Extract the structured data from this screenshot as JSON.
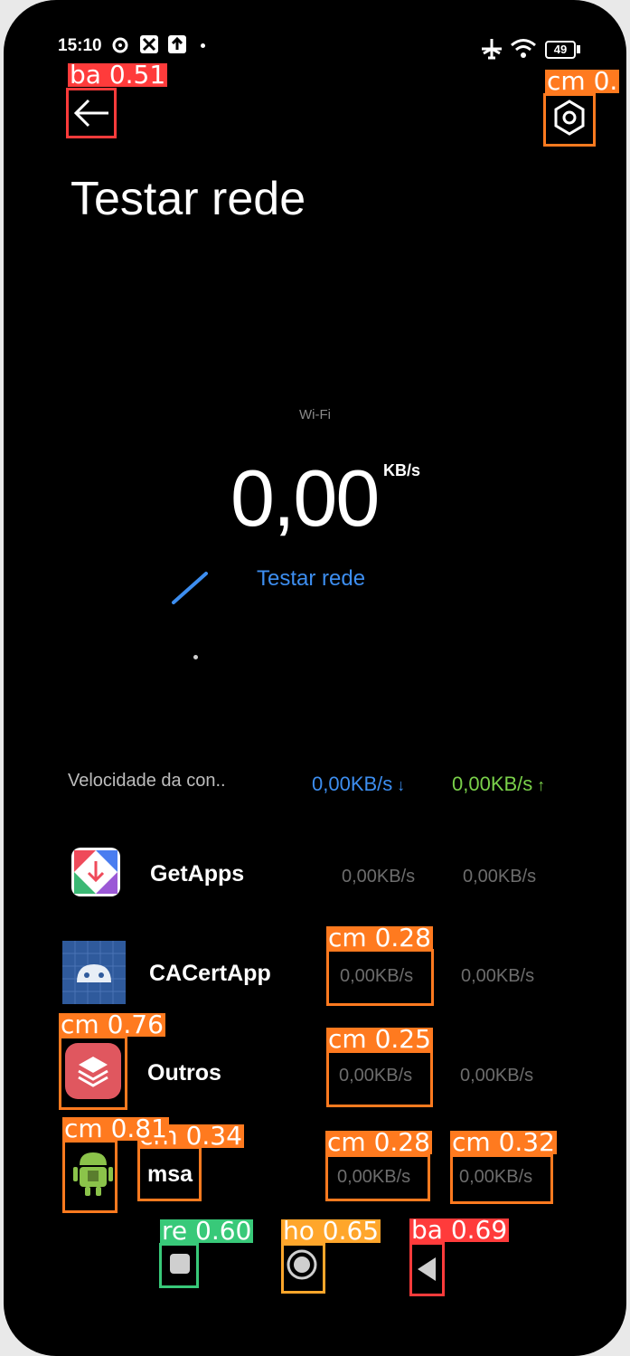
{
  "status_bar": {
    "time": "15:10",
    "battery": "49"
  },
  "page": {
    "title": "Testar rede"
  },
  "speed": {
    "network": "Wi-Fi",
    "value": "0,00",
    "unit": "KB/s",
    "test_link": "Testar rede"
  },
  "connection": {
    "label": "Velocidade da con..",
    "download": "0,00KB/s",
    "upload": "0,00KB/s"
  },
  "apps": [
    {
      "name": "GetApps",
      "down": "0,00KB/s",
      "up": "0,00KB/s"
    },
    {
      "name": "CACertApp",
      "down": "0,00KB/s",
      "up": "0,00KB/s"
    },
    {
      "name": "Outros",
      "down": "0,00KB/s",
      "up": "0,00KB/s"
    },
    {
      "name": "msa",
      "down": "0,00KB/s",
      "up": "0,00KB/s"
    }
  ],
  "detections": [
    {
      "label": "ba 0.51"
    },
    {
      "label": "cm 0."
    },
    {
      "label": "cm 0.28"
    },
    {
      "label": "cm 0.76"
    },
    {
      "label": "cm 0.25"
    },
    {
      "label": "cm 0.81"
    },
    {
      "label": "cm 0.34"
    },
    {
      "label": "cm 0.28"
    },
    {
      "label": "cm 0.32"
    },
    {
      "label": "re 0.60"
    },
    {
      "label": "ho 0.65"
    },
    {
      "label": "ba 0.69"
    }
  ],
  "colors": {
    "accent_blue": "#3d8ef0",
    "upload_green": "#7ad14a",
    "box_orange": "#ff7a1f",
    "box_red": "#ff3b3b",
    "box_green": "#38c979",
    "box_gold": "#ffa62b"
  }
}
